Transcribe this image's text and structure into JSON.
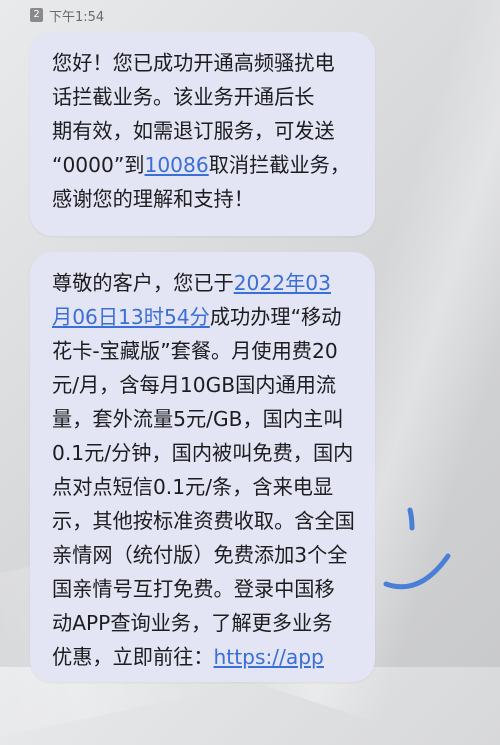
{
  "status_bar": {
    "sim_slot": "2",
    "time": "下午1:54"
  },
  "messages": [
    {
      "lines": [
        "您好！您已成功开通高频骚扰电",
        "话拦截业务。该业务开通后长",
        "期有效，如需退订服务，可发送",
        "“0000”到",
        "取消拦截业务，",
        "感谢您的理解和支持！"
      ],
      "number_link": "10086"
    },
    {
      "lines": [
        "尊敬的客户，您已于",
        "2022年03",
        "月06日13时54分",
        "成功办理“移动",
        "花卡-宝藏版”套餐。月使用费20",
        "元/月，含每月10GB国内通用流",
        "量，套外流量5元/GB，国内主叫",
        "0.1元/分钟，国内被叫免费，国内",
        "点对点短信0.1元/条，含来电显",
        "示，其他按标准资费收取。含全国",
        "亲情网（统付版）免费添加3个全",
        "国亲情号互打免费。登录中国移",
        "动APP查询业务，了解更多业务",
        "优惠，立即前往：",
        "https://app"
      ]
    }
  ],
  "colors": {
    "bubble": "#e3e4f4",
    "link": "#3a6fd6",
    "smile_doodle": "#4a7fd8"
  },
  "icons": {
    "sim": "sim-2-badge",
    "doodle": "smile-doodle-icon"
  }
}
